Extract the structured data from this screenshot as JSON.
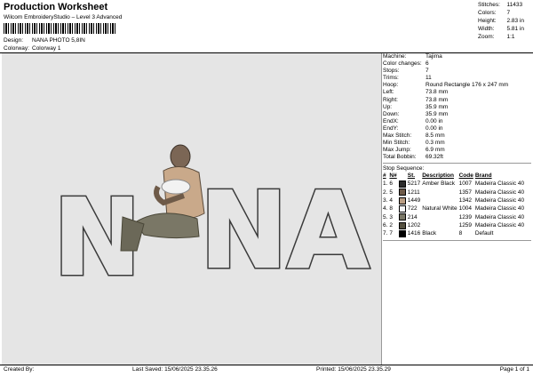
{
  "header": {
    "title": "Production Worksheet",
    "subtitle": "Wilcom EmbroideryStudio – Level 3 Advanced",
    "design_label": "Design:",
    "design_value": "NANA PHOTO 5,8IN",
    "colorway_label": "Colorway:",
    "colorway_value": "Colorway 1",
    "stats": [
      {
        "label": "Stitches:",
        "value": "11433"
      },
      {
        "label": "Colors:",
        "value": "7"
      },
      {
        "label": "Height:",
        "value": "2.83 in"
      },
      {
        "label": "Width:",
        "value": "5.81 in"
      },
      {
        "label": "Zoom:",
        "value": "1:1"
      }
    ]
  },
  "design": {
    "word_left": "N",
    "word_right": "NA"
  },
  "machine_info": [
    {
      "label": "Machine:",
      "value": "Tajima"
    },
    {
      "label": "Color changes:",
      "value": "6"
    },
    {
      "label": "Stops:",
      "value": "7"
    },
    {
      "label": "Trims:",
      "value": "11"
    },
    {
      "label": "Hoop:",
      "value": "Round Rectangle 176 x 247 mm"
    },
    {
      "label": "Left:",
      "value": "73.8 mm"
    },
    {
      "label": "Right:",
      "value": "73.8 mm"
    },
    {
      "label": "Up:",
      "value": "35.9 mm"
    },
    {
      "label": "Down:",
      "value": "35.9 mm"
    },
    {
      "label": "EndX:",
      "value": "0.00 in"
    },
    {
      "label": "EndY:",
      "value": "0.00 in"
    },
    {
      "label": "Max Stitch:",
      "value": "8.5 mm"
    },
    {
      "label": "Min Stitch:",
      "value": "0.3 mm"
    },
    {
      "label": "Max Jump:",
      "value": "6.9 mm"
    },
    {
      "label": "Total Bobbin:",
      "value": "69.32ft"
    }
  ],
  "stop_sequence": {
    "title": "Stop Sequence:",
    "columns": [
      "#",
      "N#",
      "St.",
      "Description",
      "Code",
      "Brand"
    ],
    "rows": [
      {
        "num": "1.",
        "n": "6",
        "color": "#2b2b2b",
        "st": "5217",
        "desc": "Amber Black",
        "code": "1007",
        "brand": "Madeira Classic 40"
      },
      {
        "num": "2.",
        "n": "5",
        "color": "#6e5a48",
        "st": "1211",
        "desc": "",
        "code": "1357",
        "brand": "Madeira Classic 40"
      },
      {
        "num": "3.",
        "n": "4",
        "color": "#b99d83",
        "st": "1449",
        "desc": "",
        "code": "1342",
        "brand": "Madeira Classic 40"
      },
      {
        "num": "4.",
        "n": "8",
        "color": "#f4f4f4",
        "st": "722",
        "desc": "Natural White",
        "code": "1004",
        "brand": "Madeira Classic 40"
      },
      {
        "num": "5.",
        "n": "3",
        "color": "#7a7766",
        "st": "214",
        "desc": "",
        "code": "1239",
        "brand": "Madeira Classic 40"
      },
      {
        "num": "6.",
        "n": "2",
        "color": "#54503f",
        "st": "1202",
        "desc": "",
        "code": "1259",
        "brand": "Madeira Classic 40"
      },
      {
        "num": "7.",
        "n": "7",
        "color": "#000000",
        "st": "1416",
        "desc": "Black",
        "code": "8",
        "brand": "Default"
      }
    ]
  },
  "footer": {
    "created_by": "Created By:",
    "last_saved": "Last Saved: 15/06/2025 23.35.26",
    "printed": "Printed: 15/06/2025 23.35.29",
    "page": "Page 1 of 1"
  }
}
